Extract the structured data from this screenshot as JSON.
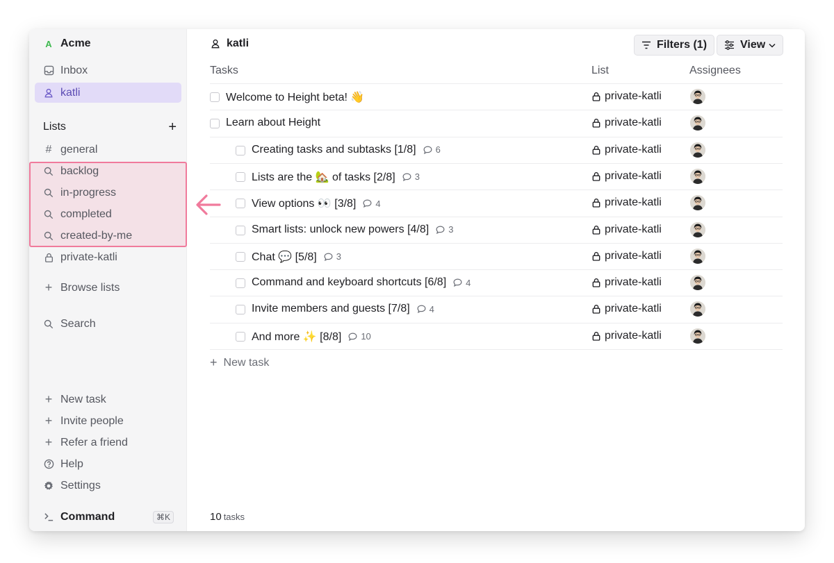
{
  "workspace": {
    "logo": "A",
    "name": "Acme",
    "logo_color": "#3fb950"
  },
  "sidebar": {
    "top_items": [
      {
        "label": "Inbox",
        "icon": "inbox-icon"
      },
      {
        "label": "katli",
        "icon": "user-icon",
        "active": true
      }
    ],
    "lists_header": "Lists",
    "lists_add": "+",
    "lists": [
      {
        "label": "general",
        "icon": "hash-icon"
      },
      {
        "label": "backlog",
        "icon": "search-icon"
      },
      {
        "label": "in-progress",
        "icon": "search-icon"
      },
      {
        "label": "completed",
        "icon": "search-icon"
      },
      {
        "label": "created-by-me",
        "icon": "search-icon"
      },
      {
        "label": "private-katli",
        "icon": "lock-icon"
      }
    ],
    "browse_lists": "Browse lists",
    "search": "Search",
    "bottom_items": [
      {
        "label": "New task",
        "icon": "plus-icon"
      },
      {
        "label": "Invite people",
        "icon": "plus-icon"
      },
      {
        "label": "Refer a friend",
        "icon": "plus-icon"
      },
      {
        "label": "Help",
        "icon": "help-icon"
      },
      {
        "label": "Settings",
        "icon": "gear-icon"
      }
    ],
    "command": {
      "label": "Command",
      "shortcut": "⌘K"
    },
    "highlight_color": "#f07a9c",
    "active_color": "#e2dbf8"
  },
  "header": {
    "title": "katli",
    "filters_label": "Filters (1)",
    "view_label": "View"
  },
  "table": {
    "columns": {
      "tasks": "Tasks",
      "list": "List",
      "assignees": "Assignees"
    },
    "rows": [
      {
        "title": "Welcome to Height beta! 👋",
        "indent": 0,
        "comments": "",
        "list": "private-katli"
      },
      {
        "title": "Learn about Height",
        "indent": 0,
        "comments": "",
        "list": "private-katli"
      },
      {
        "title": "Creating tasks and subtasks [1/8]",
        "indent": 1,
        "comments": "6",
        "list": "private-katli"
      },
      {
        "title": "Lists are the 🏡 of tasks [2/8]",
        "indent": 1,
        "comments": "3",
        "list": "private-katli"
      },
      {
        "title": "View options 👀 [3/8]",
        "indent": 1,
        "comments": "4",
        "list": "private-katli"
      },
      {
        "title": "Smart lists: unlock new powers [4/8]",
        "indent": 1,
        "comments": "3",
        "list": "private-katli"
      },
      {
        "title": "Chat 💬 [5/8]",
        "indent": 1,
        "comments": "3",
        "list": "private-katli"
      },
      {
        "title": "Command and keyboard shortcuts [6/8]",
        "indent": 1,
        "comments": "4",
        "list": "private-katli"
      },
      {
        "title": "Invite members and guests [7/8]",
        "indent": 1,
        "comments": "4",
        "list": "private-katli"
      },
      {
        "title": "And more ✨ [8/8]",
        "indent": 1,
        "comments": "10",
        "list": "private-katli"
      }
    ],
    "new_task": "New task"
  },
  "footer": {
    "count": "10",
    "unit": "tasks"
  },
  "annotation": {
    "icon": "arrow-left-icon",
    "color": "#f07a9c"
  }
}
